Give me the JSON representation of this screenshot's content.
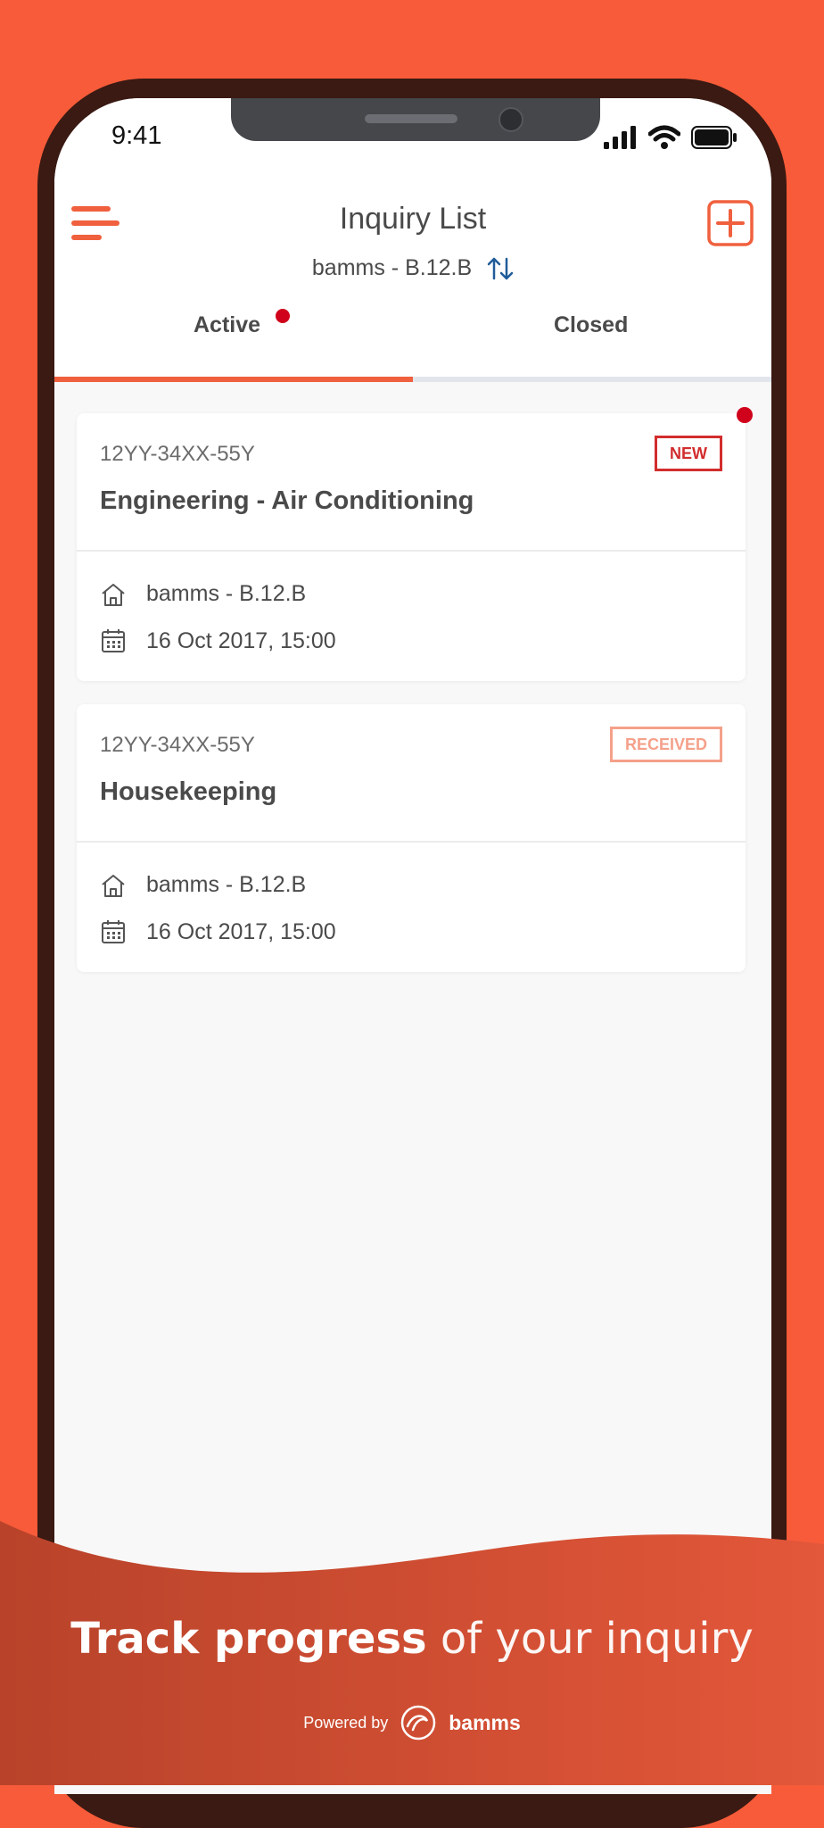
{
  "status": {
    "time": "9:41"
  },
  "header": {
    "title": "Inquiry List",
    "building": "bamms - B.12.B"
  },
  "tabs": [
    {
      "label": "Active",
      "active": true,
      "has_notification": true
    },
    {
      "label": "Closed",
      "active": false,
      "has_notification": false
    }
  ],
  "inquiries": [
    {
      "id": "12YY-34XX-55Y",
      "category": "Engineering - Air Conditioning",
      "status": "NEW",
      "building": "bamms - B.12.B",
      "datetime": "16 Oct 2017, 15:00",
      "unread": true
    },
    {
      "id": "12YY-34XX-55Y",
      "category": "Housekeeping",
      "status": "RECEIVED",
      "building": "bamms - B.12.B",
      "datetime": "16 Oct 2017, 15:00",
      "unread": false
    }
  ],
  "footer": {
    "tagline_bold": "Track progress",
    "tagline_light": "of your inquiry",
    "powered_by": "Powered by",
    "brand": "bamms"
  },
  "colors": {
    "background": "#F75B39",
    "accent": "#F0603E",
    "badge_new": "#D22D2D",
    "badge_received": "#F5A08A",
    "notification_dot": "#D0021B"
  },
  "icons": {
    "menu": "menu-icon",
    "add": "plus-square-icon",
    "switch": "swap-vertical-icon",
    "building": "home-icon",
    "date": "calendar-icon"
  }
}
